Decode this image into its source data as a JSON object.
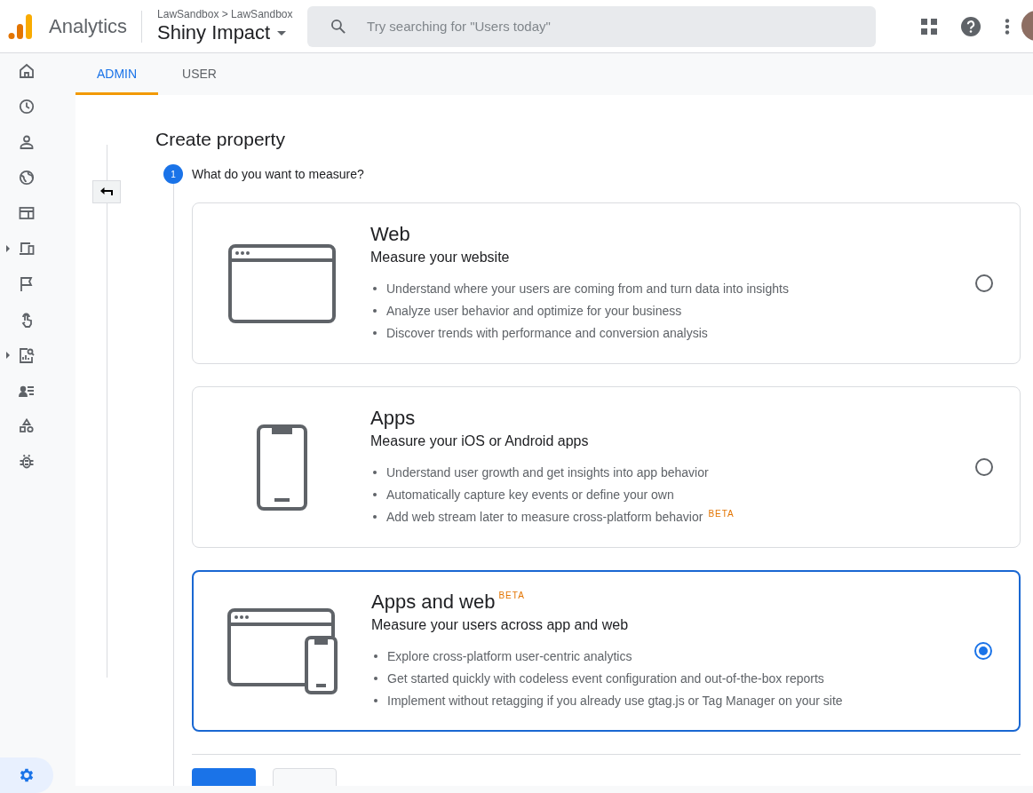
{
  "header": {
    "product": "Analytics",
    "breadcrumb": "LawSandbox > LawSandbox",
    "property": "Shiny Impact",
    "search": {
      "placeholder": "Try searching for \"Users today\""
    }
  },
  "sidebar": {
    "items": [
      {
        "expandable": false,
        "selected": false
      },
      {
        "expandable": false,
        "selected": false
      },
      {
        "expandable": false,
        "selected": false
      },
      {
        "expandable": false,
        "selected": false
      },
      {
        "expandable": false,
        "selected": false
      },
      {
        "expandable": true,
        "selected": false
      },
      {
        "expandable": false,
        "selected": false
      },
      {
        "expandable": false,
        "selected": false
      },
      {
        "expandable": true,
        "selected": false
      },
      {
        "expandable": false,
        "selected": false
      },
      {
        "expandable": false,
        "selected": false
      },
      {
        "expandable": false,
        "selected": false
      }
    ],
    "settings": {
      "selected": true
    }
  },
  "tabs": [
    {
      "label": "ADMIN",
      "selected": true
    },
    {
      "label": "USER",
      "selected": false
    }
  ],
  "page": {
    "title": "Create property",
    "step": {
      "number": "1",
      "label": "What do you want to measure?"
    }
  },
  "options": [
    {
      "kind": "web",
      "title": "Web",
      "subtitle": "Measure your website",
      "selected": false,
      "bullets": [
        {
          "text": "Understand where your users are coming from and turn data into insights"
        },
        {
          "text": "Analyze user behavior and optimize for your business"
        },
        {
          "text": "Discover trends with performance and conversion analysis"
        }
      ]
    },
    {
      "kind": "app",
      "title": "Apps",
      "subtitle": "Measure your iOS or Android apps",
      "selected": false,
      "bullets": [
        {
          "text": "Understand user growth and get insights into app behavior"
        },
        {
          "text": "Automatically capture key events or define your own"
        },
        {
          "text": "Add web stream later to measure cross-platform behavior",
          "badge": "BETA"
        }
      ]
    },
    {
      "kind": "appweb",
      "title": "Apps and web",
      "badge": "BETA",
      "subtitle": "Measure your users across app and web",
      "selected": true,
      "bullets": [
        {
          "text": "Explore cross-platform user-centric analytics"
        },
        {
          "text": "Get started quickly with codeless event configuration and out-of-the-box reports"
        },
        {
          "text": "Implement without retagging if you already use gtag.js or Tag Manager on your site"
        }
      ]
    }
  ]
}
